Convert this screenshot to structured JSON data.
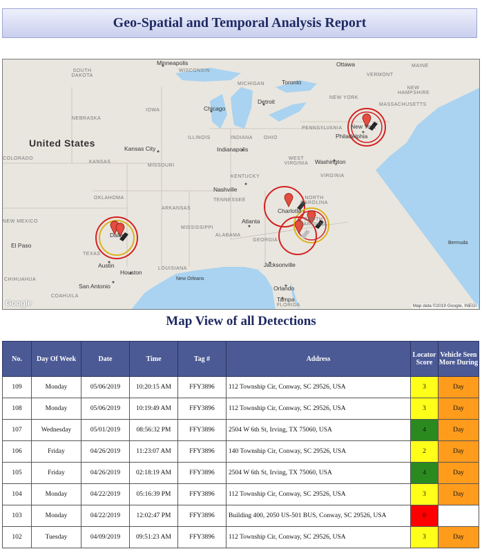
{
  "report_title": "Geo-Spatial and Temporal Analysis Report",
  "map_section_title": "Map View of all Detections",
  "map": {
    "country_label": "United States",
    "google_logo": "Google",
    "attribution": "Map data ©2019 Google, INEGI",
    "state_labels": [
      "SOUTH DAKOTA",
      "WISCONSIN",
      "MICHIGAN",
      "NEBRASKA",
      "IOWA",
      "ILLINOIS",
      "INDIANA",
      "OHIO",
      "PENNSYLVANIA",
      "NEW YORK",
      "VERMONT",
      "MAINE",
      "NEW HAMPSHIRE",
      "MASSACHUSETTS",
      "COLORADO",
      "KANSAS",
      "MISSOURI",
      "KENTUCKY",
      "WEST VIRGINIA",
      "VIRGINIA",
      "TENNESSEE",
      "NORTH CAROLINA",
      "OKLAHOMA",
      "ARKANSAS",
      "SOUTH CAROLINA",
      "MISSISSIPPI",
      "ALABAMA",
      "GEORGIA",
      "NEW MEXICO",
      "TEXAS",
      "LOUISIANA",
      "FLORIDA",
      "CHIHUAHUA",
      "COAHUILA"
    ],
    "city_labels": [
      "Minneapolis",
      "Ottawa",
      "Toronto",
      "Detroit",
      "Chicago",
      "Kansas City",
      "Indianapolis",
      "Washington",
      "Philadelphia",
      "New York",
      "Nashville",
      "Charlotte",
      "Atlanta",
      "Dallas",
      "El Paso",
      "Austin",
      "Houston",
      "San Antonio",
      "New Orleans",
      "Jacksonville",
      "Orlando",
      "Tampa",
      "Bermuda"
    ]
  },
  "table": {
    "headers": [
      "No.",
      "Day Of Week",
      "Date",
      "Time",
      "Tag #",
      "Address",
      "Locator Score",
      "Vehicle Seen More During"
    ],
    "rows": [
      {
        "no": "109",
        "day": "Monday",
        "date": "05/06/2019",
        "time": "10:20:15 AM",
        "tag": "FFY3896",
        "address": "112 Township Cir, Conway, SC 29526, USA",
        "score": "3",
        "score_color": "#ffff1a",
        "seen": "Day"
      },
      {
        "no": "108",
        "day": "Monday",
        "date": "05/06/2019",
        "time": "10:19:49 AM",
        "tag": "FFY3896",
        "address": "112 Township Cir, Conway, SC 29526, USA",
        "score": "3",
        "score_color": "#ffff1a",
        "seen": "Day"
      },
      {
        "no": "107",
        "day": "Wednesday",
        "date": "05/01/2019",
        "time": "08:56:32 PM",
        "tag": "FFY3896",
        "address": "2504 W 6th St, Irving, TX 75060, USA",
        "score": "4",
        "score_color": "#2a8a1f",
        "seen": "Day"
      },
      {
        "no": "106",
        "day": "Friday",
        "date": "04/26/2019",
        "time": "11:23:07 AM",
        "tag": "FFY3896",
        "address": "140 Township Cir, Conway, SC 29526, USA",
        "score": "2",
        "score_color": "#ffff1a",
        "seen": "Day"
      },
      {
        "no": "105",
        "day": "Friday",
        "date": "04/26/2019",
        "time": "02:18:19 AM",
        "tag": "FFY3896",
        "address": "2504 W 6th St, Irving, TX 75060, USA",
        "score": "4",
        "score_color": "#2a8a1f",
        "seen": "Day"
      },
      {
        "no": "104",
        "day": "Monday",
        "date": "04/22/2019",
        "time": "05:16:39 PM",
        "tag": "FFY3896",
        "address": "112 Township Cir, Conway, SC 29526, USA",
        "score": "3",
        "score_color": "#ffff1a",
        "seen": "Day"
      },
      {
        "no": "103",
        "day": "Monday",
        "date": "04/22/2019",
        "time": "12:02:47 PM",
        "tag": "FFY3896",
        "address": "Building 400, 2050 US-501 BUS, Conway, SC 29526, USA",
        "score": "0",
        "score_color": "#ff0000",
        "seen": ""
      },
      {
        "no": "102",
        "day": "Tuesday",
        "date": "04/09/2019",
        "time": "09:51:23 AM",
        "tag": "FFY3896",
        "address": "112 Township Cir, Conway, SC 29526, USA",
        "score": "3",
        "score_color": "#ffff1a",
        "seen": "Day"
      }
    ]
  }
}
